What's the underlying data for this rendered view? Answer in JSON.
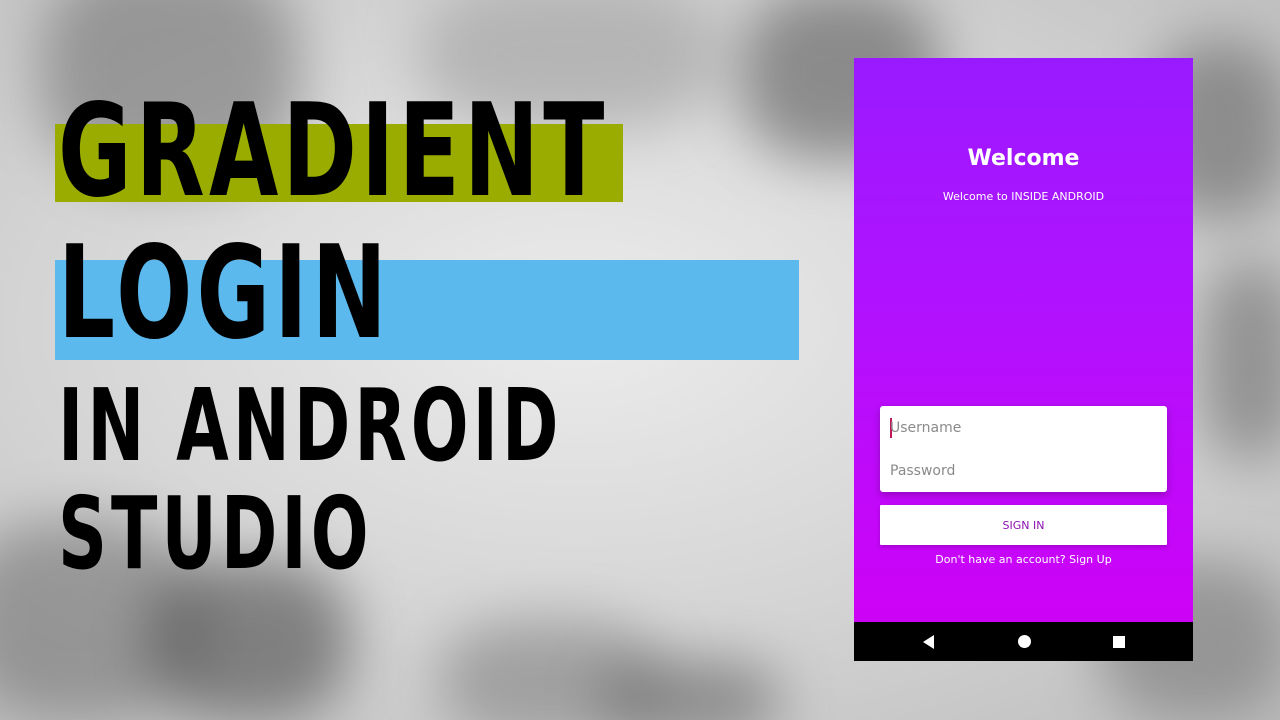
{
  "headline": {
    "line1": "GRADIENT",
    "line2": "LOGIN",
    "line3": "IN ANDROID",
    "line4": "STUDIO"
  },
  "colors": {
    "highlight_green": "#9aac00",
    "highlight_blue": "#5bb9ee",
    "gradient_top": "#9a1aff",
    "gradient_bottom": "#d000f5",
    "button_text": "#8e0fb0"
  },
  "phone": {
    "welcome_title": "Welcome",
    "welcome_subtitle": "Welcome to INSIDE ANDROID",
    "username_placeholder": "Username",
    "password_placeholder": "Password",
    "signin_label": "SIGN IN",
    "signup_text": "Don't have an account? Sign Up",
    "nav": {
      "back_icon": "triangle-back-icon",
      "home_icon": "circle-home-icon",
      "recent_icon": "square-recent-apps-icon"
    }
  }
}
